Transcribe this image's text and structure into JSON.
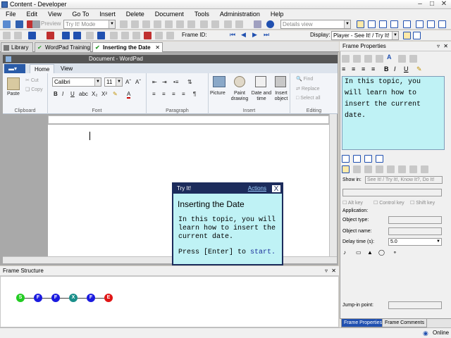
{
  "window": {
    "title": "Content - Developer"
  },
  "menu": [
    "File",
    "Edit",
    "View",
    "Go To",
    "Insert",
    "Delete",
    "Document",
    "Tools",
    "Administration",
    "Help"
  ],
  "toolbar": {
    "preview_label": "Preview",
    "mode_combo": "Try It! Mode",
    "view_combo": "Details view",
    "frame_id_label": "Frame ID:",
    "display_label": "Display:",
    "display_combo": "Player - See It! / Try It!"
  },
  "tabs": [
    {
      "label": "Library",
      "active": false
    },
    {
      "label": "WordPad Training",
      "active": false
    },
    {
      "label": "Inserting the Date",
      "active": true
    }
  ],
  "wordpad": {
    "title": "Document - WordPad",
    "ribbon_tabs": [
      "Home",
      "View"
    ],
    "clipboard": {
      "paste": "Paste",
      "cut": "Cut",
      "copy": "Copy",
      "group": "Clipboard"
    },
    "font": {
      "family": "Calibri",
      "size": "11",
      "group": "Font"
    },
    "paragraph_group": "Paragraph",
    "insert": {
      "picture": "Picture",
      "paint": "Paint drawing",
      "datetime": "Date and time",
      "object": "Insert object",
      "group": "Insert"
    },
    "editing": {
      "find": "Find",
      "replace": "Replace",
      "select_all": "Select all",
      "group": "Editing"
    }
  },
  "bubble": {
    "header": "Try It!",
    "actions": "Actions",
    "close": "X",
    "title": "Inserting the Date",
    "body": "In this topic, you will learn how to insert the current date.",
    "prompt_prefix": "Press [Enter] to ",
    "prompt_link": "start."
  },
  "frame_structure": {
    "title": "Frame Structure",
    "nodes": [
      {
        "letter": "S",
        "color": "#22cc22"
      },
      {
        "letter": "F",
        "color": "#1a1adf"
      },
      {
        "letter": "F",
        "color": "#1a1adf"
      },
      {
        "letter": "X",
        "color": "#1a8f8a"
      },
      {
        "letter": "F",
        "color": "#1a1adf"
      },
      {
        "letter": "E",
        "color": "#e01515"
      }
    ]
  },
  "frame_properties": {
    "title": "Frame Properties",
    "text": "In this topic, you will learn how to insert the current date.",
    "show_in_label": "Show in:",
    "show_in_value": "See It! / Try It!, Know It?, Do It!",
    "alt_key": "Alt key",
    "control_key": "Control key",
    "shift_key": "Shift key",
    "application": "Application:",
    "object_type": "Object type:",
    "object_name": "Object name:",
    "delay_time": "Delay time (s):",
    "delay_value": "5.0",
    "jump_in": "Jump-in point:",
    "tabs": [
      "Frame Properties",
      "Frame Comments"
    ]
  },
  "status": {
    "online": "Online"
  }
}
